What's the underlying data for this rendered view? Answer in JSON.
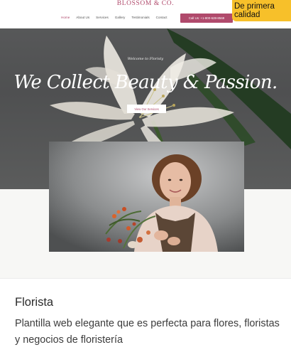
{
  "preview": {
    "brand": "BLOSSOM & CO.",
    "nav": {
      "items": [
        "Home",
        "About Us",
        "Services",
        "Gallery",
        "Testimonials",
        "Contact"
      ],
      "active": "Home",
      "call_label": "Call Us: +1-800-628-8569"
    },
    "hero": {
      "welcome": "Welcome to Floristy",
      "headline": "We Collect Beauty & Passion.",
      "button_label": "View Our Services"
    }
  },
  "badge": {
    "label": "De primera calidad"
  },
  "template": {
    "title": "Florista",
    "description": "Plantilla web elegante que es perfecta para flores, floristas y negocios de floristería"
  },
  "colors": {
    "accent": "#b04a6c",
    "badge": "#f7c02a",
    "hero_bg": "#575859"
  }
}
